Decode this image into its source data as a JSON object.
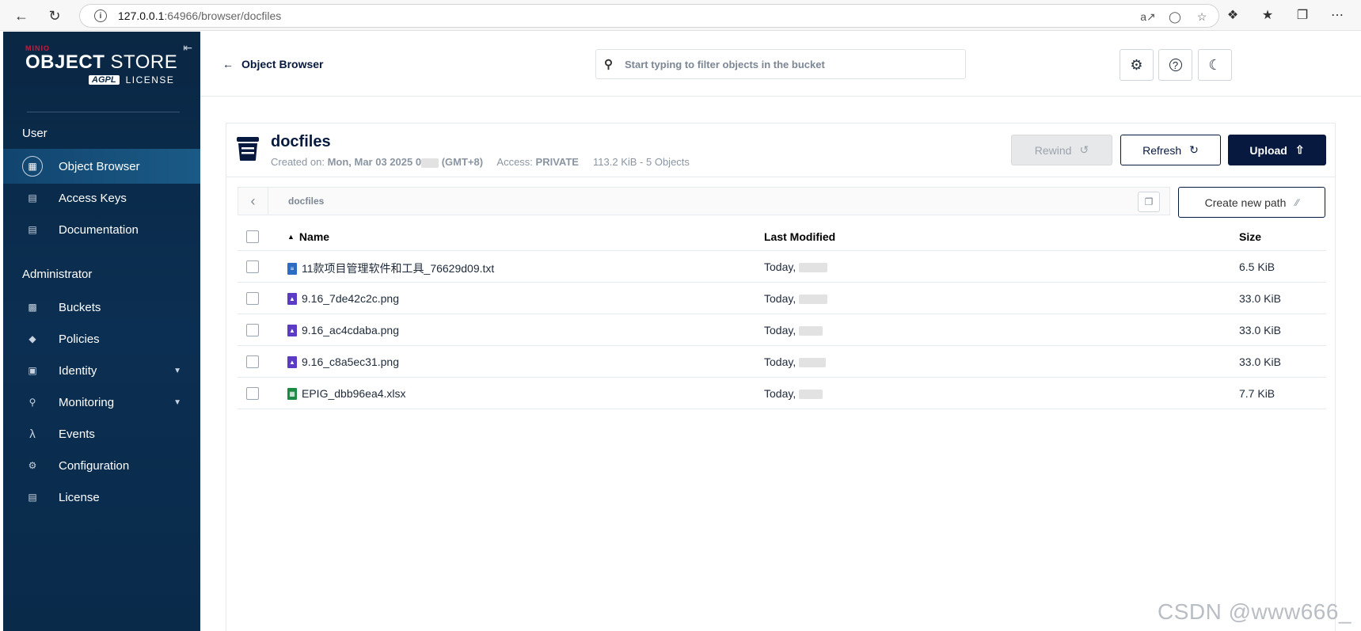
{
  "browser": {
    "url_host": "127.0.0.1",
    "url_path": ":64966/browser/docfiles"
  },
  "sidebar": {
    "logo_minio": "MINIO",
    "logo_object": "OBJECT",
    "logo_store": " STORE",
    "logo_agpl": "AGPL",
    "logo_license": "LICENSE",
    "section_user": "User",
    "section_admin": "Administrator",
    "items": [
      {
        "label": "Object Browser"
      },
      {
        "label": "Access Keys"
      },
      {
        "label": "Documentation"
      },
      {
        "label": "Buckets"
      },
      {
        "label": "Policies"
      },
      {
        "label": "Identity"
      },
      {
        "label": "Monitoring"
      },
      {
        "label": "Events"
      },
      {
        "label": "Configuration"
      },
      {
        "label": "License"
      }
    ]
  },
  "topbar": {
    "back_label": "Object Browser",
    "search_placeholder": "Start typing to filter objects in the bucket"
  },
  "bucket": {
    "name": "docfiles",
    "created_label": "Created on:",
    "created_value": "Mon, Mar 03 2025 0",
    "timezone": "(GMT+8)",
    "access_label": "Access:",
    "access_value": "PRIVATE",
    "summary": "113.2 KiB - 5 Objects",
    "rewind_label": "Rewind",
    "refresh_label": "Refresh",
    "upload_label": "Upload"
  },
  "path": {
    "current": "docfiles",
    "new_path_label": "Create new path"
  },
  "table": {
    "headers": {
      "name": "Name",
      "modified": "Last Modified",
      "size": "Size"
    },
    "rows": [
      {
        "name": "11款项目管理软件和工具_76629d09.txt",
        "modified": "Today,",
        "size": "6.5 KiB",
        "type": "txt"
      },
      {
        "name": "9.16_7de42c2c.png",
        "modified": "Today,",
        "size": "33.0 KiB",
        "type": "img"
      },
      {
        "name": "9.16_ac4cdaba.png",
        "modified": "Today,",
        "size": "33.0 KiB",
        "type": "img"
      },
      {
        "name": "9.16_c8a5ec31.png",
        "modified": "Today,",
        "size": "33.0 KiB",
        "type": "img"
      },
      {
        "name": "EPIG_dbb96ea4.xlsx",
        "modified": "Today,",
        "size": "7.7 KiB",
        "type": "xls"
      }
    ]
  },
  "watermark": "CSDN @www666_",
  "colors": {
    "sidebar_bg": "#0a2744",
    "primary": "#07193e",
    "active_item": "#1b5a86"
  }
}
